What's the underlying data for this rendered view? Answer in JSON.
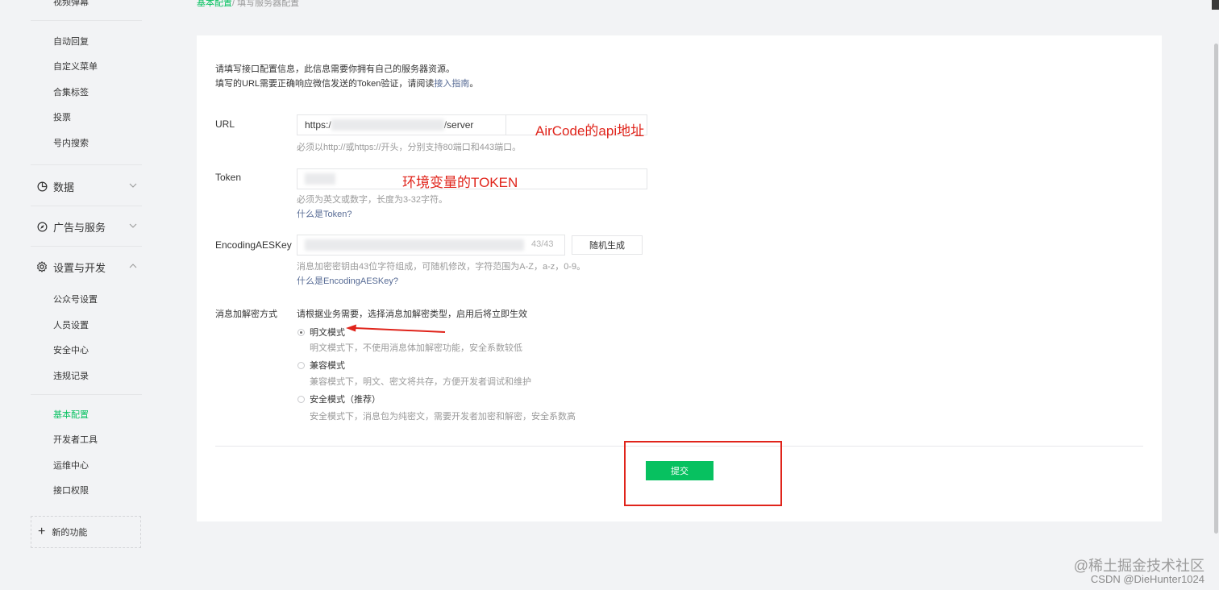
{
  "sidebar": {
    "top_cut_item": "视频弹幕",
    "group1_items": [
      "自动回复",
      "自定义菜单",
      "合集标签",
      "投票",
      "号内搜索"
    ],
    "groups": [
      {
        "label": "数据",
        "icon": "pie-chart-icon",
        "expanded": false
      },
      {
        "label": "广告与服务",
        "icon": "compass-icon",
        "expanded": false
      },
      {
        "label": "设置与开发",
        "icon": "gear-icon",
        "expanded": true
      }
    ],
    "settings_items": [
      "公众号设置",
      "人员设置",
      "安全中心",
      "违规记录"
    ],
    "dev_items": [
      "基本配置",
      "开发者工具",
      "运维中心",
      "接口权限"
    ],
    "active_item": "基本配置",
    "new_function": "新的功能"
  },
  "breadcrumb": {
    "link": "基本配置",
    "current": "/ 填写服务器配置"
  },
  "intro": {
    "line1": "请填写接口配置信息，此信息需要你拥有自己的服务器资源。",
    "line2_prefix": "填写的URL需要正确响应微信发送的Token验证，请阅读",
    "line2_link": "接入指南",
    "line2_suffix": "。"
  },
  "url_field": {
    "label": "URL",
    "value_prefix": "https:/",
    "value_suffix": "/server",
    "hint": "必须以http://或https://开头，分别支持80端口和443端口。",
    "annotation": "AirCode的api地址"
  },
  "token_field": {
    "label": "Token",
    "hint": "必须为英文或数字，长度为3-32字符。",
    "help_link": "什么是Token?",
    "annotation": "环境变量的TOKEN"
  },
  "aes_field": {
    "label": "EncodingAESKey",
    "counter": "43/43",
    "random_button": "随机生成",
    "hint": "消息加密密钥由43位字符组成，可随机修改，字符范围为A-Z，a-z，0-9。",
    "help_link": "什么是EncodingAESKey?"
  },
  "encryption": {
    "label": "消息加解密方式",
    "instruction": "请根据业务需要，选择消息加解密类型，启用后将立即生效",
    "options": [
      {
        "label": "明文模式",
        "desc": "明文模式下，不使用消息体加解密功能，安全系数较低",
        "selected": true
      },
      {
        "label": "兼容模式",
        "desc": "兼容模式下，明文、密文将共存，方便开发者调试和维护",
        "selected": false
      },
      {
        "label": "安全模式（推荐）",
        "desc": "安全模式下，消息包为纯密文，需要开发者加密和解密，安全系数高",
        "selected": false
      }
    ]
  },
  "submit_button": "提交",
  "watermark": {
    "line1": "@稀土掘金技术社区",
    "line2": "CSDN @DieHunter1024"
  },
  "colors": {
    "brand_green": "#07c160",
    "annotation_red": "#e0241b",
    "link_blue": "#576b95"
  }
}
